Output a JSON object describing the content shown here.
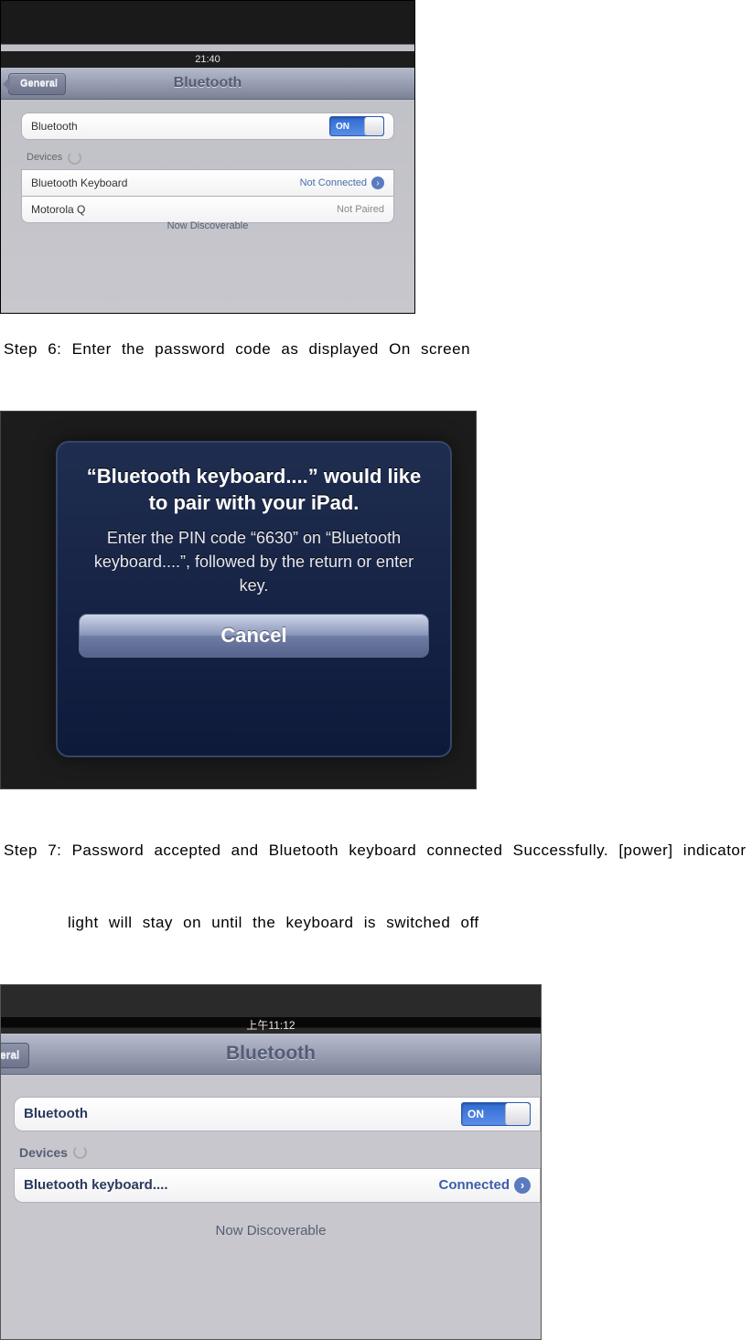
{
  "steps": {
    "step6": "Step 6: Enter the password code as displayed On screen",
    "step7_line1": "Step 7: Password accepted and Bluetooth keyboard connected Successfully. [power] indicator",
    "step7_line2": "light will stay on until the keyboard is switched off"
  },
  "screenshot1": {
    "time": "21:40",
    "back": "General",
    "title": "Bluetooth",
    "bluetooth_label": "Bluetooth",
    "toggle": "ON",
    "devices_label": "Devices",
    "device1_name": "Bluetooth Keyboard",
    "device1_status": "Not Connected",
    "device2_name": "Motorola Q",
    "device2_status": "Not Paired",
    "discoverable": "Now Discoverable"
  },
  "screenshot2": {
    "title": "“Bluetooth keyboard....” would like to pair with your iPad.",
    "body": "Enter the PIN code “6630” on “Bluetooth keyboard....”, followed by the return or enter key.",
    "cancel": "Cancel"
  },
  "screenshot3": {
    "time": "上午11:12",
    "back": "eneral",
    "title": "Bluetooth",
    "bluetooth_label": "Bluetooth",
    "toggle": "ON",
    "devices_label": "Devices",
    "device1_name": "Bluetooth keyboard....",
    "device1_status": "Connected",
    "discoverable": "Now Discoverable"
  }
}
